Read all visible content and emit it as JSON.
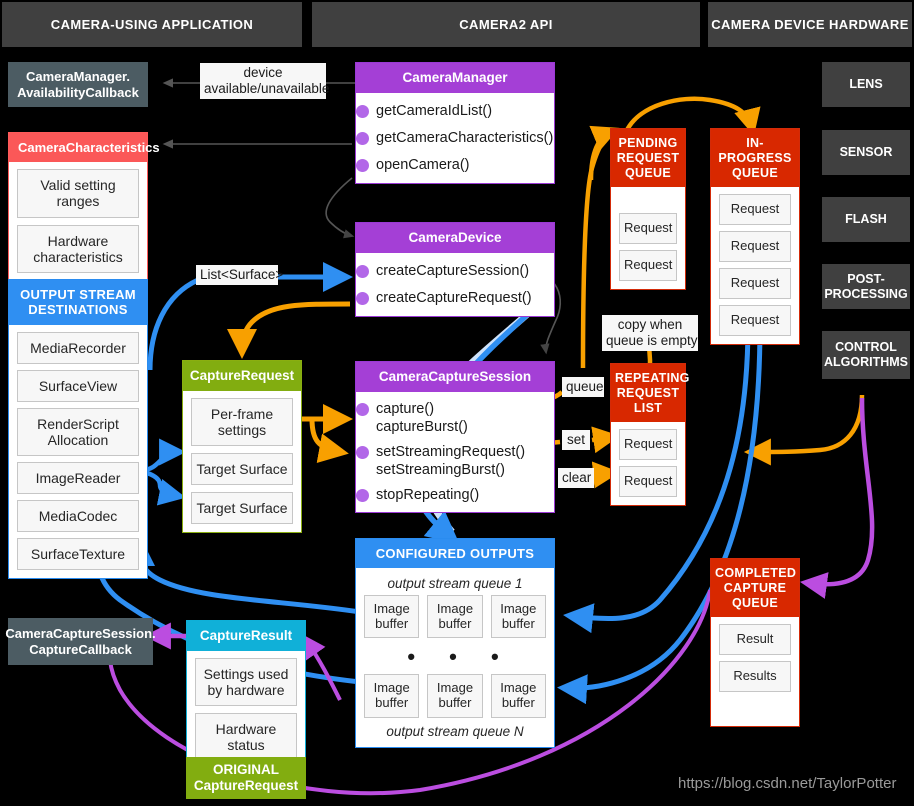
{
  "columns": [
    {
      "id": "app",
      "title": "CAMERA-USING APPLICATION"
    },
    {
      "id": "api",
      "title": "CAMERA2 API"
    },
    {
      "id": "hw",
      "title": "CAMERA DEVICE HARDWARE"
    }
  ],
  "colors": {
    "background": "#000000",
    "header_bar": "#404040",
    "purple": "#a43fd6",
    "red": "#d82800",
    "blue": "#2f8ff2",
    "green": "#82ad10",
    "cyan": "#10b0d8",
    "pink": "#fb5858",
    "slate": "#4c5c63",
    "arrow_orange": "#f8a000",
    "arrow_blue": "#2f8ff2",
    "arrow_magenta": "#bb4de0",
    "arrow_gray": "#555555",
    "slot_fill": "#f7f7f7",
    "slot_border": "#c6c6c6"
  },
  "availability_callback": {
    "label": "CameraManager.\nAvailabilityCallback",
    "line1": "CameraManager.",
    "line2": "AvailabilityCallback"
  },
  "camera_characteristics": {
    "title": "CameraCharacteristics",
    "items": [
      {
        "line1": "Valid setting",
        "line2": "ranges"
      },
      {
        "line1": "Hardware",
        "line2": "characteristics"
      }
    ]
  },
  "output_stream_destinations": {
    "title_line1": "OUTPUT STREAM",
    "title_line2": "DESTINATIONS",
    "items": [
      {
        "line1": "MediaRecorder",
        "line2": ""
      },
      {
        "line1": "SurfaceView",
        "line2": ""
      },
      {
        "line1": "RenderScript",
        "line2": "Allocation"
      },
      {
        "line1": "ImageReader",
        "line2": ""
      },
      {
        "line1": "MediaCodec",
        "line2": ""
      },
      {
        "line1": "SurfaceTexture",
        "line2": ""
      }
    ]
  },
  "capture_callback": {
    "line1": "CameraCaptureSession.",
    "line2": "CaptureCallback"
  },
  "camera_manager": {
    "title": "CameraManager",
    "methods": [
      "getCameraIdList()",
      "getCameraCharacteristics()",
      "openCamera()"
    ]
  },
  "camera_device": {
    "title": "CameraDevice",
    "methods": [
      "createCaptureSession()",
      "createCaptureRequest()"
    ]
  },
  "capture_request": {
    "title": "CaptureRequest",
    "items": [
      {
        "line1": "Per-frame",
        "line2": "settings"
      },
      {
        "line1": "Target Surface",
        "line2": ""
      },
      {
        "line1": "Target Surface",
        "line2": ""
      }
    ]
  },
  "camera_capture_session": {
    "title": "CameraCaptureSession",
    "methods": [
      {
        "line1": "capture()",
        "line2": "captureBurst()"
      },
      {
        "line1": "setStreamingRequest()",
        "line2": "setStreamingBurst()"
      },
      {
        "line1": "stopRepeating()",
        "line2": ""
      }
    ]
  },
  "configured_outputs": {
    "title": "CONFIGURED OUTPUTS",
    "queue1_label": "output stream queue 1",
    "queueN_label": "output stream queue N",
    "buffer_label_line1": "Image",
    "buffer_label_line2": "buffer",
    "row1_count": 3,
    "rowN_count": 3,
    "ellipsis": "• • •"
  },
  "pending_request_queue": {
    "title_lines": [
      "PENDING",
      "REQUEST",
      "QUEUE"
    ],
    "items": [
      "Request",
      "Request"
    ]
  },
  "in_progress_queue": {
    "title_lines": [
      "IN-PROGRESS",
      "QUEUE"
    ],
    "items": [
      "Request",
      "Request",
      "Request",
      "Request"
    ]
  },
  "repeating_request_list": {
    "title_lines": [
      "REPEATING",
      "REQUEST",
      "LIST"
    ],
    "items": [
      "Request",
      "Request"
    ]
  },
  "completed_capture_queue": {
    "title_lines": [
      "COMPLETED",
      "CAPTURE",
      "QUEUE"
    ],
    "items": [
      "Result",
      "Results"
    ]
  },
  "capture_result": {
    "title": "CaptureResult",
    "items": [
      {
        "line1": "Settings used",
        "line2": "by hardware"
      },
      {
        "line1": "Hardware",
        "line2": "status"
      }
    ]
  },
  "original_capture_request": {
    "line1": "ORIGINAL",
    "line2": "CaptureRequest"
  },
  "hardware_blocks": [
    {
      "line1": "LENS",
      "line2": ""
    },
    {
      "line1": "SENSOR",
      "line2": ""
    },
    {
      "line1": "FLASH",
      "line2": ""
    },
    {
      "line1": "POST-",
      "line2": "PROCESSING"
    },
    {
      "line1": "CONTROL",
      "line2": "ALGORITHMS"
    }
  ],
  "edge_labels": {
    "device_available": {
      "line1": "device",
      "line2": "available/unavailable"
    },
    "list_surface": "List<Surface>",
    "copy_when_empty": {
      "line1": "copy when",
      "line2": "queue is empty"
    },
    "queue": "queue",
    "set": "set",
    "clear": "clear"
  },
  "watermark": "https://blog.csdn.net/TaylorPotter"
}
